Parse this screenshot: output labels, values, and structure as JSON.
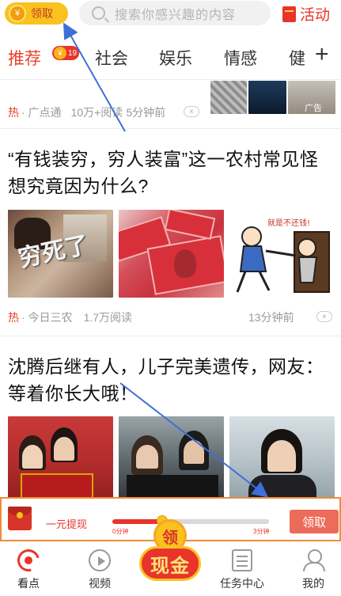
{
  "topbar": {
    "lingqu_label": "领取",
    "coin_glyph": "¥",
    "search_placeholder": "搜索你感兴趣的内容",
    "activity_label": "活动"
  },
  "tabs": {
    "items": [
      "推荐",
      "社会",
      "娱乐",
      "情感",
      "健"
    ],
    "badge": "19",
    "badge_coin": "¥",
    "plus": "+"
  },
  "feed": {
    "item1": {
      "hot": "热",
      "source": "· 广点通",
      "reads": "10万+阅读",
      "time": "5分钟前",
      "ad_label": "广告",
      "close": "×"
    },
    "item2": {
      "title": "“有钱装穷，穷人装富”这一农村常见怪想究竟因为什么?",
      "graffiti": "穷死了",
      "cartoon_text": "就是不还钱!",
      "hot": "热",
      "source": "· 今日三农",
      "reads": "1.7万阅读",
      "time": "13分钟前",
      "close": "×"
    },
    "item3": {
      "title": "沈腾后继有人，儿子完美遗传，网友：等着你长大哦！"
    }
  },
  "cashbar": {
    "label": "一元提现",
    "progress": 0.32,
    "tick_min": "0分钟",
    "tick_max": "3分钟",
    "claim_label": "领取"
  },
  "bottomnav": {
    "items": [
      "看点",
      "视频",
      "任务中心",
      "我的"
    ],
    "center_top": "领",
    "center_bottom": "现金"
  },
  "colors": {
    "accent": "#e8342a",
    "gold": "#f9c21e",
    "arrow": "#3e6fd8"
  }
}
